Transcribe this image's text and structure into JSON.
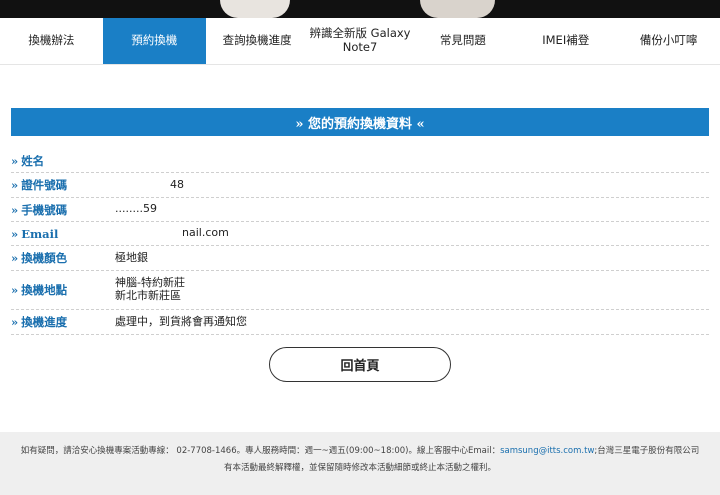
{
  "nav": {
    "tabs": [
      {
        "label": "換機辦法",
        "active": false
      },
      {
        "label": "預約換機",
        "active": true
      },
      {
        "label": "查詢換機進度",
        "active": false
      },
      {
        "label": "辨識全新版 Galaxy Note7",
        "active": false
      },
      {
        "label": "常見問題",
        "active": false
      },
      {
        "label": "IMEI補登",
        "active": false
      },
      {
        "label": "備份小叮嚀",
        "active": false
      }
    ]
  },
  "section": {
    "title": "» 您的預約換機資料 «"
  },
  "info": {
    "rows": [
      {
        "label": "姓名",
        "value": "",
        "value2": ""
      },
      {
        "label": "證件號碼",
        "value": "48",
        "value2": ""
      },
      {
        "label": "手機號碼",
        "value": "........59",
        "value2": ""
      },
      {
        "label": "Email",
        "value": "nail.com",
        "value2": ""
      },
      {
        "label": "換機顏色",
        "value": "極地銀",
        "value2": ""
      },
      {
        "label": "換機地點",
        "value": "神腦-特約新莊",
        "value2": "新北市新莊區"
      },
      {
        "label": "換機進度",
        "value": "處理中，到貨將會再通知您",
        "value2": ""
      }
    ]
  },
  "home_button": {
    "label": "回首頁"
  },
  "footer": {
    "line1_before": "如有疑問，請洽安心換機專案活動專線： 02-7708-1466。專人服務時間：週一~週五(09:00~18:00)。線上客服中心Email：",
    "email": "samsung@itts.com.tw",
    "line1_after": ";台灣三星電子股份有限公司",
    "line2": "有本活動最終解釋權，並保留隨時修改本活動細節或終止本活動之權利。"
  },
  "colors": {
    "accent": "#1a7fc6",
    "label": "#1a6fae"
  }
}
